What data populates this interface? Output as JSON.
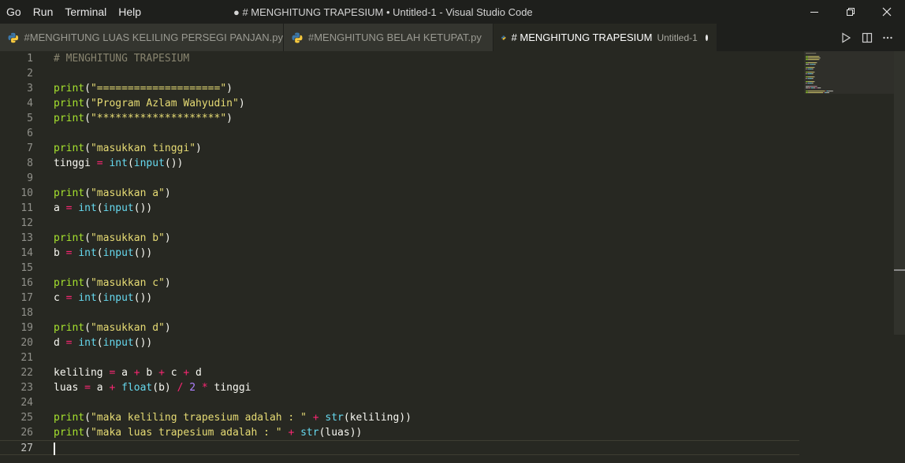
{
  "menu": [
    "Go",
    "Run",
    "Terminal",
    "Help"
  ],
  "window_title": "● # MENGHITUNG TRAPESIUM • Untitled-1 - Visual Studio Code",
  "tabs": [
    {
      "label": "#MENGHITUNG LUAS KELILING PERSEGI PANJAN.py",
      "description": "",
      "active": false,
      "dirty": false
    },
    {
      "label": "#MENGHITUNG BELAH KETUPAT.py",
      "description": "",
      "active": false,
      "dirty": false
    },
    {
      "label": "# MENGHITUNG TRAPESIUM",
      "description": "Untitled-1",
      "active": true,
      "dirty": true
    }
  ],
  "current_line": 27,
  "code_lines": [
    [
      [
        "cmt",
        "# MENGHITUNG TRAPESIUM"
      ]
    ],
    [],
    [
      [
        "fn",
        "print"
      ],
      [
        "p",
        "("
      ],
      [
        "str",
        "\"====================\""
      ],
      [
        "p",
        ")"
      ]
    ],
    [
      [
        "fn",
        "print"
      ],
      [
        "p",
        "("
      ],
      [
        "str",
        "\"Program Azlam Wahyudin\""
      ],
      [
        "p",
        ")"
      ]
    ],
    [
      [
        "fn",
        "print"
      ],
      [
        "p",
        "("
      ],
      [
        "str",
        "\"********************\""
      ],
      [
        "p",
        ")"
      ]
    ],
    [],
    [
      [
        "fn",
        "print"
      ],
      [
        "p",
        "("
      ],
      [
        "str",
        "\"masukkan tinggi\""
      ],
      [
        "p",
        ")"
      ]
    ],
    [
      [
        "p",
        "tinggi "
      ],
      [
        "op",
        "="
      ],
      [
        "p",
        " "
      ],
      [
        "bi",
        "int"
      ],
      [
        "p",
        "("
      ],
      [
        "bi",
        "input"
      ],
      [
        "p",
        "())"
      ]
    ],
    [],
    [
      [
        "fn",
        "print"
      ],
      [
        "p",
        "("
      ],
      [
        "str",
        "\"masukkan a\""
      ],
      [
        "p",
        ")"
      ]
    ],
    [
      [
        "p",
        "a "
      ],
      [
        "op",
        "="
      ],
      [
        "p",
        " "
      ],
      [
        "bi",
        "int"
      ],
      [
        "p",
        "("
      ],
      [
        "bi",
        "input"
      ],
      [
        "p",
        "())"
      ]
    ],
    [],
    [
      [
        "fn",
        "print"
      ],
      [
        "p",
        "("
      ],
      [
        "str",
        "\"masukkan b\""
      ],
      [
        "p",
        ")"
      ]
    ],
    [
      [
        "p",
        "b "
      ],
      [
        "op",
        "="
      ],
      [
        "p",
        " "
      ],
      [
        "bi",
        "int"
      ],
      [
        "p",
        "("
      ],
      [
        "bi",
        "input"
      ],
      [
        "p",
        "())"
      ]
    ],
    [],
    [
      [
        "fn",
        "print"
      ],
      [
        "p",
        "("
      ],
      [
        "str",
        "\"masukkan c\""
      ],
      [
        "p",
        ")"
      ]
    ],
    [
      [
        "p",
        "c "
      ],
      [
        "op",
        "="
      ],
      [
        "p",
        " "
      ],
      [
        "bi",
        "int"
      ],
      [
        "p",
        "("
      ],
      [
        "bi",
        "input"
      ],
      [
        "p",
        "())"
      ]
    ],
    [],
    [
      [
        "fn",
        "print"
      ],
      [
        "p",
        "("
      ],
      [
        "str",
        "\"masukkan d\""
      ],
      [
        "p",
        ")"
      ]
    ],
    [
      [
        "p",
        "d "
      ],
      [
        "op",
        "="
      ],
      [
        "p",
        " "
      ],
      [
        "bi",
        "int"
      ],
      [
        "p",
        "("
      ],
      [
        "bi",
        "input"
      ],
      [
        "p",
        "())"
      ]
    ],
    [],
    [
      [
        "p",
        "keliling "
      ],
      [
        "op",
        "="
      ],
      [
        "p",
        " a "
      ],
      [
        "op",
        "+"
      ],
      [
        "p",
        " b "
      ],
      [
        "op",
        "+"
      ],
      [
        "p",
        " c "
      ],
      [
        "op",
        "+"
      ],
      [
        "p",
        " d"
      ]
    ],
    [
      [
        "p",
        "luas "
      ],
      [
        "op",
        "="
      ],
      [
        "p",
        " a "
      ],
      [
        "op",
        "+"
      ],
      [
        "p",
        " "
      ],
      [
        "bi",
        "float"
      ],
      [
        "p",
        "(b) "
      ],
      [
        "op",
        "/"
      ],
      [
        "p",
        " "
      ],
      [
        "num",
        "2"
      ],
      [
        "p",
        " "
      ],
      [
        "op",
        "*"
      ],
      [
        "p",
        " tinggi"
      ]
    ],
    [],
    [
      [
        "fn",
        "print"
      ],
      [
        "p",
        "("
      ],
      [
        "str",
        "\"maka keliling trapesium adalah : \""
      ],
      [
        "p",
        " "
      ],
      [
        "op",
        "+"
      ],
      [
        "p",
        " "
      ],
      [
        "bi",
        "str"
      ],
      [
        "p",
        "(keliling))"
      ]
    ],
    [
      [
        "fn",
        "print"
      ],
      [
        "p",
        "("
      ],
      [
        "str",
        "\"maka luas trapesium adalah : \""
      ],
      [
        "p",
        " "
      ],
      [
        "op",
        "+"
      ],
      [
        "p",
        " "
      ],
      [
        "bi",
        "str"
      ],
      [
        "p",
        "(luas))"
      ]
    ],
    []
  ],
  "colors": {
    "editor_bg": "#272822",
    "chrome_bg": "#1e1f1c",
    "function": "#a6e22e",
    "string": "#e6db74",
    "comment": "#88846f",
    "operator": "#f92672",
    "builtin": "#66d9ef",
    "number": "#ae81ff"
  },
  "icons": {
    "tab_file": "python-icon",
    "run": "play-icon",
    "split": "split-editor-icon",
    "more": "more-actions-icon",
    "window": [
      "minimize-icon",
      "restore-icon",
      "close-icon"
    ]
  }
}
